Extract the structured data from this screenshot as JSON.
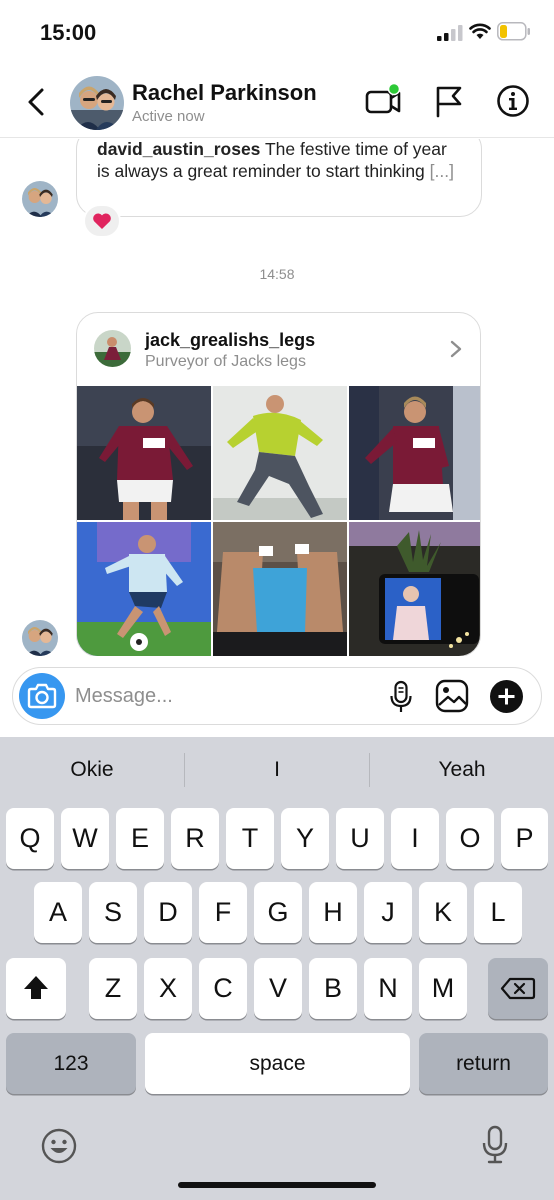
{
  "status_bar": {
    "time": "15:00"
  },
  "header": {
    "name": "Rachel Parkinson",
    "status": "Active now",
    "icons": [
      "back-arrow-icon",
      "video-call-icon",
      "flag-icon",
      "info-icon"
    ]
  },
  "chat": {
    "shared_post": {
      "username": "david_austin_roses",
      "text": "The festive time of year is always a great reminder to start thinking",
      "more": "[...]"
    },
    "reaction": "❤️",
    "timestamp": "14:58",
    "profile_card": {
      "username": "jack_grealishs_legs",
      "bio": "Purveyor of Jacks legs"
    }
  },
  "composer": {
    "placeholder": "Message..."
  },
  "keyboard": {
    "suggestions": [
      "Okie",
      "I",
      "Yeah"
    ],
    "row1": [
      "Q",
      "W",
      "E",
      "R",
      "T",
      "Y",
      "U",
      "I",
      "O",
      "P"
    ],
    "row2": [
      "A",
      "S",
      "D",
      "F",
      "G",
      "H",
      "J",
      "K",
      "L"
    ],
    "row3": [
      "Z",
      "X",
      "C",
      "V",
      "B",
      "N",
      "M"
    ],
    "numbers_label": "123",
    "space_label": "space",
    "return_label": "return"
  },
  "colors": {
    "accent": "#3797f0",
    "online_dot": "#2dc937",
    "heart": "#e0245e"
  }
}
